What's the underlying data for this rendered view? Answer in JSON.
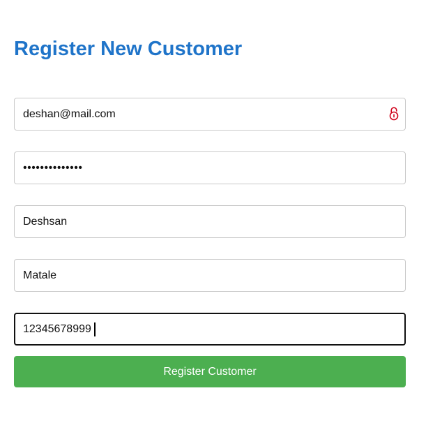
{
  "page": {
    "title": "Register New Customer"
  },
  "form": {
    "email": {
      "value": "deshan@mail.com",
      "icon": "lock-icon",
      "icon_color": "#d0021b"
    },
    "password": {
      "value": "deshan12345678"
    },
    "name": {
      "value": "Deshsan"
    },
    "address": {
      "value": "Matale"
    },
    "phone": {
      "value": "12345678999"
    },
    "submit_label": "Register Customer"
  },
  "colors": {
    "title": "#1f74c9",
    "button": "#4caf50",
    "button_text": "#ffffff",
    "field_border": "#c9c9c9",
    "focused_border": "#111111"
  }
}
